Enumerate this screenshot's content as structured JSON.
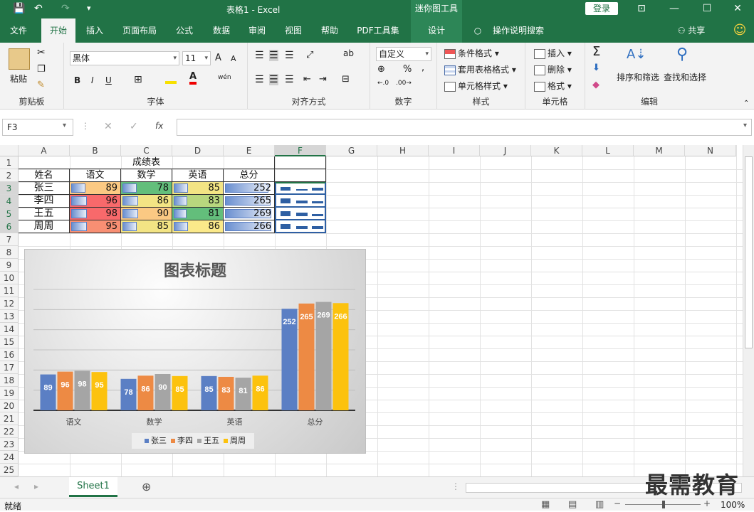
{
  "window": {
    "title": "表格1  -  Excel",
    "context_tools": "迷你图工具",
    "login_label": "登录",
    "save_glyph": "💾",
    "undo_glyph": "↶",
    "redo_glyph": "↷",
    "qat_more_glyph": "▾",
    "ribbon_display_glyph": "⊡",
    "minimize_glyph": "—",
    "maximize_glyph": "☐",
    "close_glyph": "✕"
  },
  "tabs": {
    "file": "文件",
    "home": "开始",
    "insert": "插入",
    "layout": "页面布局",
    "formula": "公式",
    "data": "数据",
    "review": "审阅",
    "view": "视图",
    "help": "帮助",
    "pdf": "PDF工具集",
    "design": "设计",
    "tell": "操作说明搜索",
    "share": "共享",
    "smile": "☺"
  },
  "ribbon": {
    "clipboard": {
      "label": "剪贴板",
      "paste": "粘贴"
    },
    "font": {
      "label": "字体",
      "name": "黑体",
      "size": "11",
      "grow": "A",
      "shrink": "A",
      "bold": "B",
      "italic": "I",
      "underline": "U",
      "wen": "wén"
    },
    "align": {
      "label": "对齐方式"
    },
    "number": {
      "label": "数字",
      "format": "自定义",
      "percent": "%",
      "comma": ","
    },
    "styles": {
      "label": "样式",
      "cond": "条件格式",
      "table": "套用表格格式",
      "cell": "单元格样式"
    },
    "cells": {
      "label": "单元格",
      "insert": "插入",
      "delete": "删除",
      "format": "格式"
    },
    "editing": {
      "label": "编辑",
      "sum": "Σ",
      "sort": "排序和筛选",
      "find": "查找和选择"
    }
  },
  "formula_bar": {
    "name_box": "F3",
    "fx": "fx",
    "cancel": "✕",
    "enter": "✓",
    "value": ""
  },
  "columns": [
    "A",
    "B",
    "C",
    "D",
    "E",
    "F",
    "G",
    "H",
    "I",
    "J",
    "K",
    "L",
    "M",
    "N"
  ],
  "rows": [
    "1",
    "2",
    "3",
    "4",
    "5",
    "6",
    "7",
    "8",
    "9",
    "10",
    "11",
    "12",
    "13",
    "14",
    "15",
    "16",
    "17",
    "18",
    "19",
    "20",
    "21",
    "22",
    "23",
    "24",
    "25"
  ],
  "table": {
    "title": "成绩表",
    "headers": [
      "姓名",
      "语文",
      "数学",
      "英语",
      "总分"
    ],
    "rows": [
      {
        "name": "张三",
        "chinese": "89",
        "math": "78",
        "english": "85",
        "total": "252"
      },
      {
        "name": "李四",
        "chinese": "96",
        "math": "86",
        "english": "83",
        "total": "265"
      },
      {
        "name": "王五",
        "chinese": "98",
        "math": "90",
        "english": "81",
        "total": "269"
      },
      {
        "name": "周周",
        "chinese": "95",
        "math": "85",
        "english": "86",
        "total": "266"
      }
    ],
    "databar_fraction": [
      [
        0.3,
        0.3,
        0.3,
        0.92
      ],
      [
        0.33,
        0.33,
        0.29,
        0.97
      ],
      [
        0.34,
        0.34,
        0.28,
        0.99
      ],
      [
        0.33,
        0.3,
        0.3,
        0.98
      ]
    ],
    "cell_colors": {
      "chinese": [
        "#fbc983",
        "#f8696b",
        "#f8696b",
        "#f88f73"
      ],
      "math": [
        "#63be7b",
        "#f3e484",
        "#fbc983",
        "#f3e484"
      ],
      "english": [
        "#f3e484",
        "#b8d77e",
        "#63be7b",
        "#fbe98a"
      ]
    },
    "sparkline_color": "#2e5fa3"
  },
  "chart_data": {
    "type": "bar",
    "title": "图表标题",
    "categories": [
      "语文",
      "数学",
      "英语",
      "总分"
    ],
    "series": [
      {
        "name": "张三",
        "values": [
          89,
          78,
          85,
          252
        ],
        "color": "#5b7fc4"
      },
      {
        "name": "李四",
        "values": [
          96,
          86,
          83,
          265
        ],
        "color": "#ed8a44"
      },
      {
        "name": "王五",
        "values": [
          98,
          90,
          81,
          269
        ],
        "color": "#a5a5a5"
      },
      {
        "name": "周周",
        "values": [
          95,
          85,
          86,
          266
        ],
        "color": "#fcc20e"
      }
    ],
    "ylim": [
      0,
      300
    ],
    "grid": true,
    "legend": "bottom"
  },
  "sheets": {
    "active": "Sheet1",
    "add": "⊕"
  },
  "status": {
    "ready": "就绪",
    "zoom": "100%"
  },
  "watermark": "最需教育"
}
